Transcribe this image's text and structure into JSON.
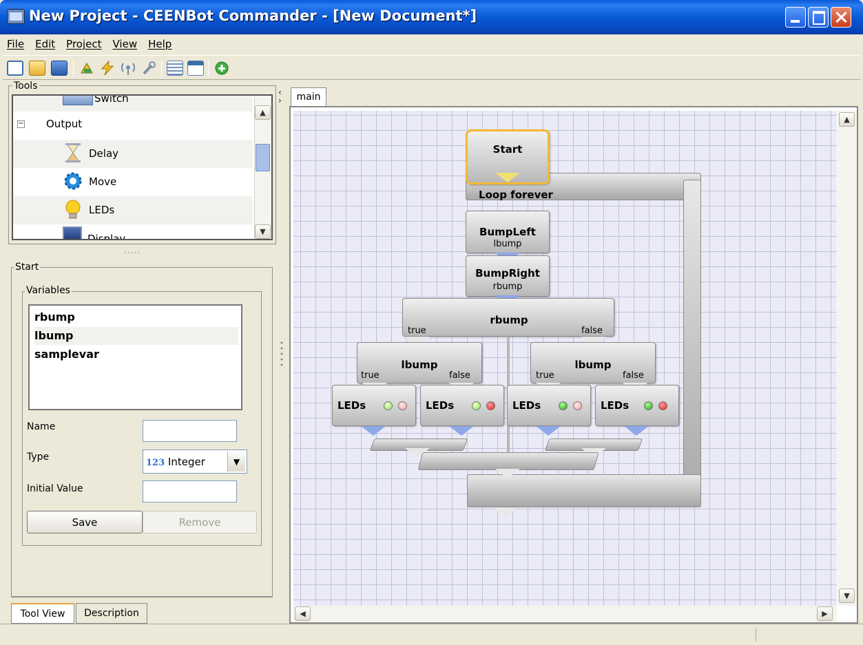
{
  "window": {
    "title": "New Project - CEENBot Commander - [New Document*]"
  },
  "menu": [
    "File",
    "Edit",
    "Project",
    "View",
    "Help"
  ],
  "toolbar": {
    "icons": [
      "new-project-icon",
      "open-icon",
      "save-icon",
      "upload-icon",
      "flash-icon",
      "wireless-icon",
      "wrench-icon",
      "list-icon",
      "window-icon",
      "add-icon"
    ]
  },
  "tools": {
    "legend": "Tools",
    "items": [
      {
        "label": "Switch",
        "icon": "switch-icon"
      },
      {
        "label": "Output",
        "icon": "collapse-icon"
      },
      {
        "label": "Delay",
        "icon": "hourglass-icon"
      },
      {
        "label": "Move",
        "icon": "gear-icon"
      },
      {
        "label": "LEDs",
        "icon": "lightbulb-icon"
      },
      {
        "label": "Display",
        "icon": "display-icon"
      }
    ],
    "splitter": "....."
  },
  "start_panel": {
    "legend": "Start",
    "variables_legend": "Variables",
    "variables": [
      "rbump",
      "lbump",
      "samplevar"
    ],
    "name_label": "Name",
    "name_value": "",
    "type_label": "Type",
    "type_prefix": "123",
    "type_value": "Integer",
    "initial_label": "Initial Value",
    "initial_value": "",
    "save_label": "Save",
    "remove_label": "Remove"
  },
  "bottom_tabs": [
    "Tool View",
    "Description"
  ],
  "canvas": {
    "tab": "main",
    "start": "Start",
    "loop": "Loop forever",
    "bumpleft": {
      "title": "BumpLeft",
      "var": "lbump"
    },
    "bumpright": {
      "title": "BumpRight",
      "var": "rbump"
    },
    "rbump_if": {
      "title": "rbump",
      "true": "true",
      "false": "false"
    },
    "lbump_if_left": {
      "title": "lbump",
      "true": "true",
      "false": "false"
    },
    "lbump_if_right": {
      "title": "lbump",
      "true": "true",
      "false": "false"
    },
    "leds": [
      "LEDs",
      "LEDs",
      "LEDs",
      "LEDs"
    ]
  },
  "colors": {
    "titlebar": "#0a5bd8",
    "canvas_bg": "#ebebf7",
    "grid": "#c0c0d8",
    "selection": "#f5b830",
    "connector": "#8fa8e8"
  }
}
